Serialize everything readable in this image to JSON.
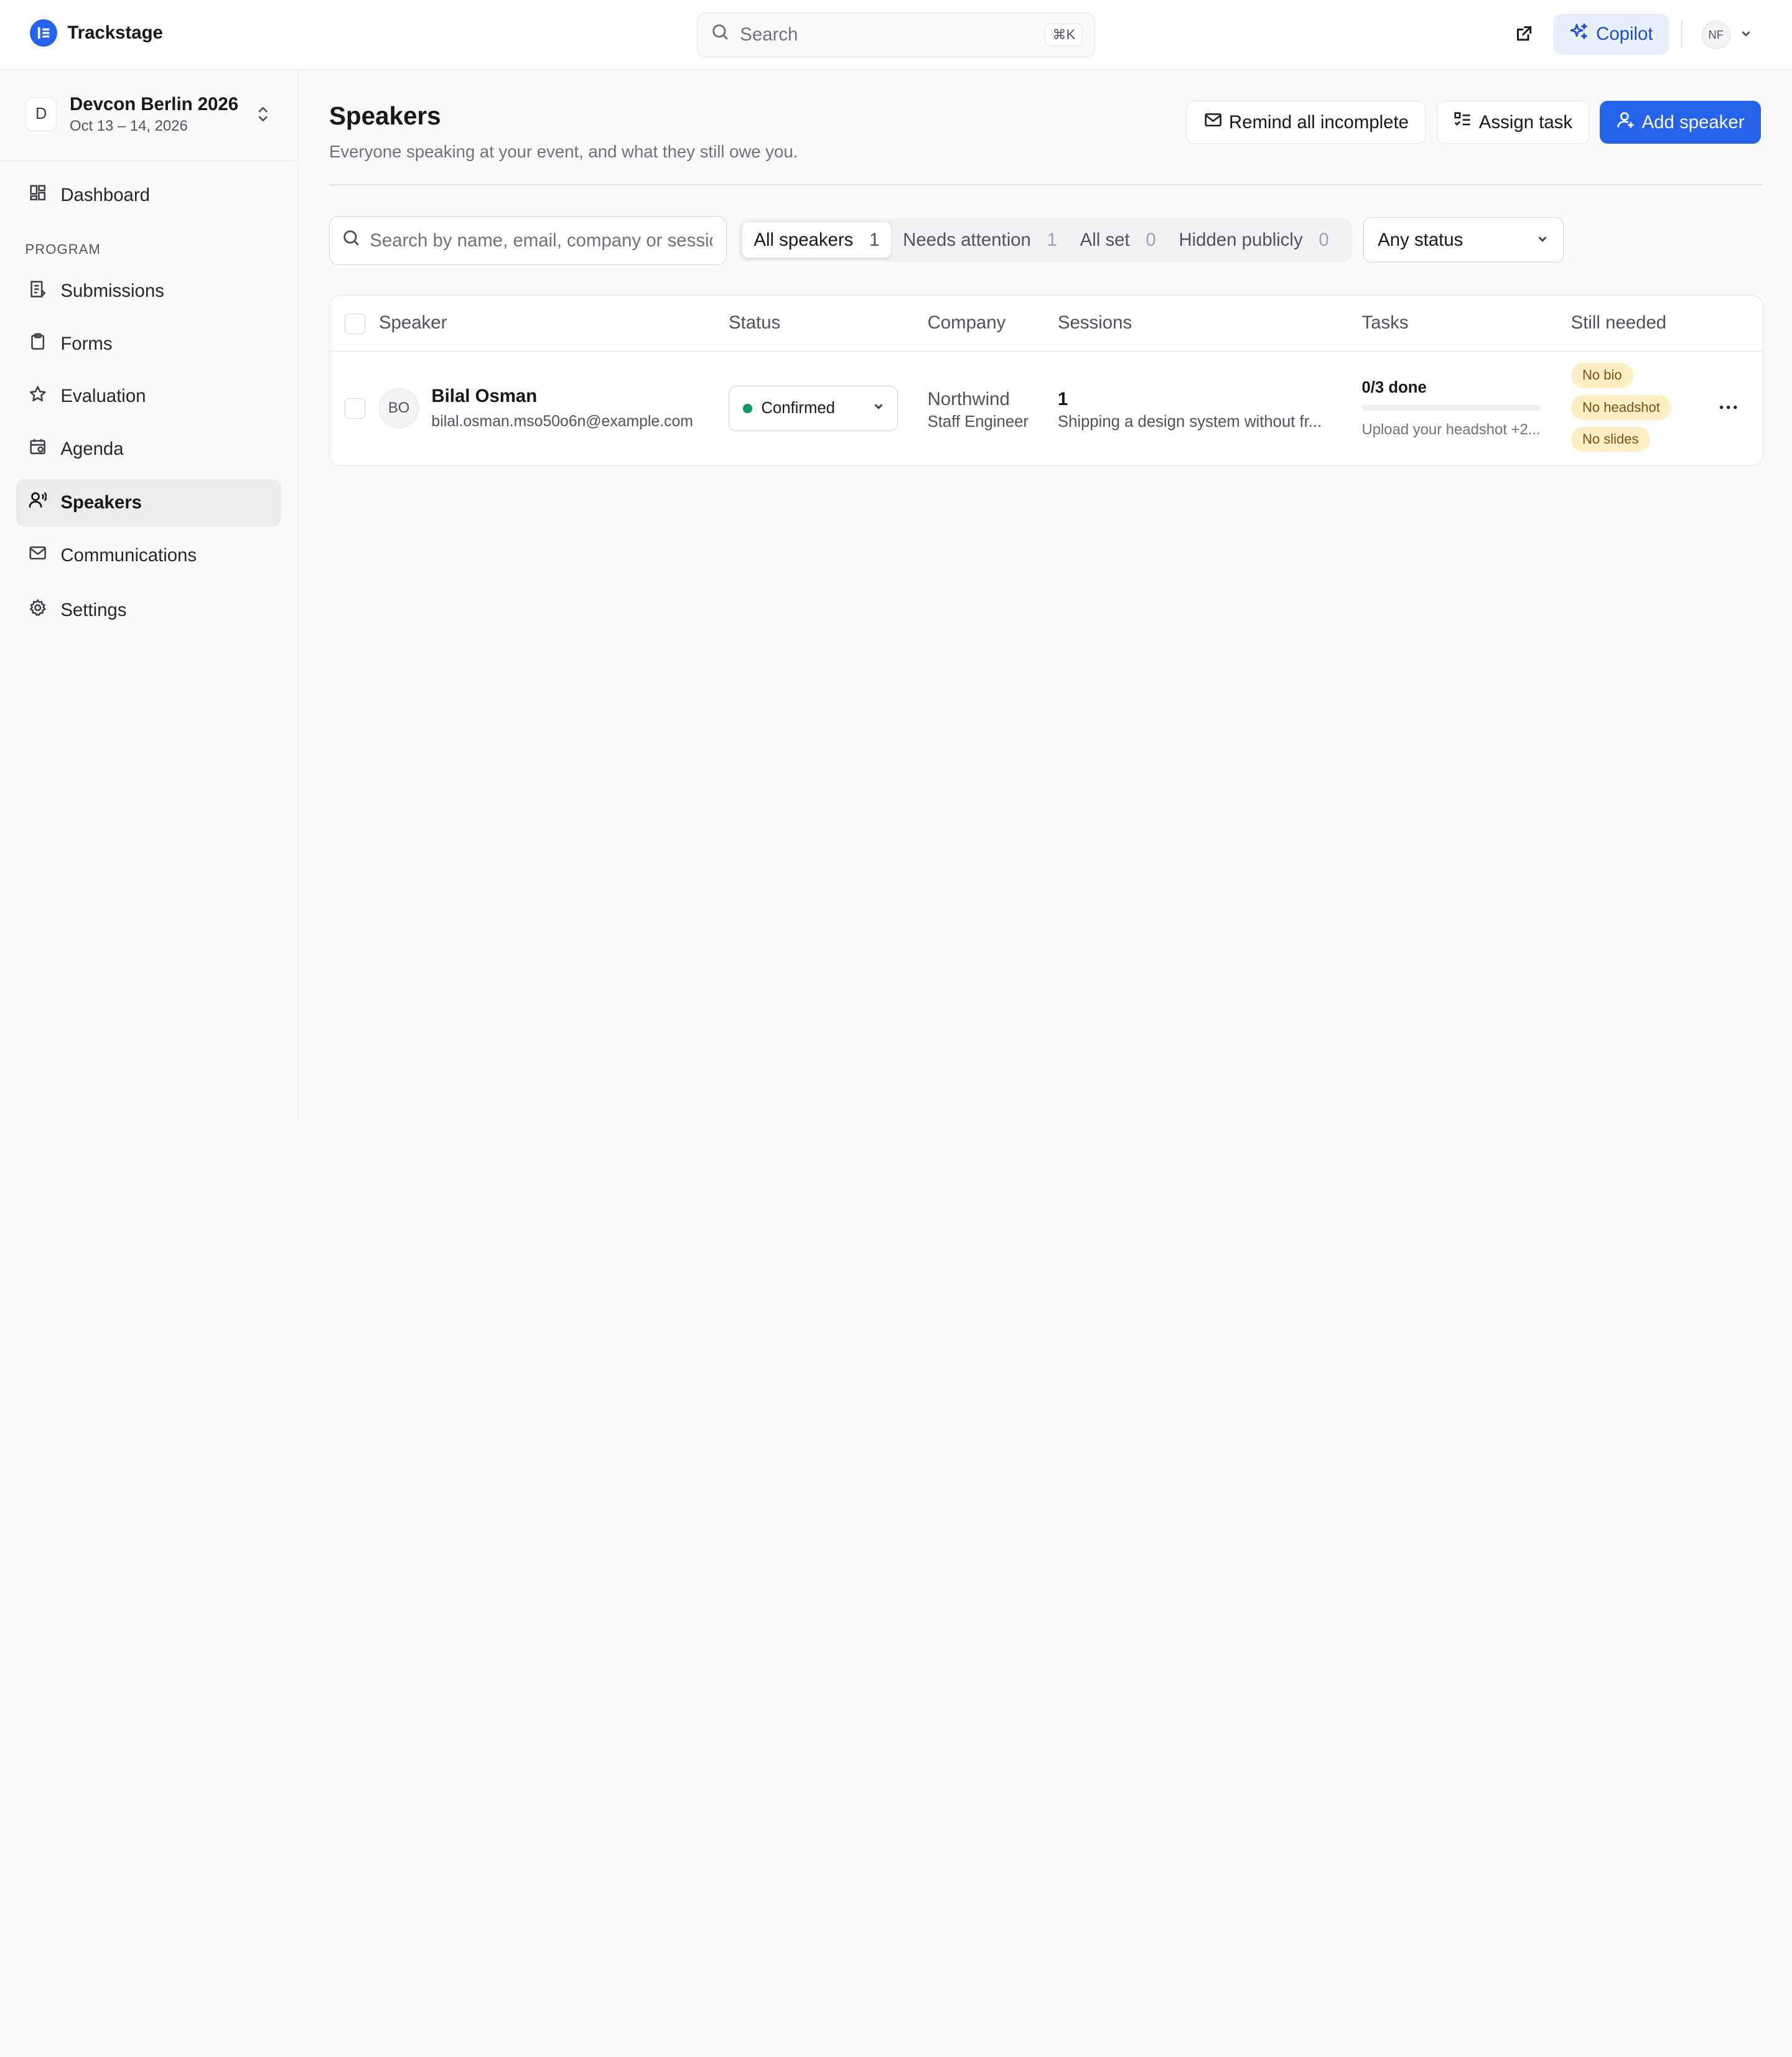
{
  "app": {
    "name": "Trackstage",
    "search_placeholder": "Search",
    "search_shortcut": "⌘K",
    "copilot_label": "Copilot",
    "user_initials": "NF",
    "accent": "#2563eb"
  },
  "event": {
    "badge": "D",
    "name": "Devcon Berlin 2026",
    "dates": "Oct 13 – 14, 2026"
  },
  "sidebar": {
    "dashboard": "Dashboard",
    "section_label": "PROGRAM",
    "items": [
      {
        "label": "Submissions",
        "icon": "submissions-icon"
      },
      {
        "label": "Forms",
        "icon": "clipboard-icon"
      },
      {
        "label": "Evaluation",
        "icon": "star-icon"
      },
      {
        "label": "Agenda",
        "icon": "calendar-icon"
      },
      {
        "label": "Speakers",
        "icon": "speaker-icon",
        "active": true
      },
      {
        "label": "Communications",
        "icon": "mail-icon"
      },
      {
        "label": "Settings",
        "icon": "gear-icon"
      }
    ]
  },
  "page": {
    "title": "Speakers",
    "subtitle": "Everyone speaking at your event, and what they still owe you.",
    "remind_label": "Remind all incomplete",
    "assign_label": "Assign task",
    "add_label": "Add speaker"
  },
  "filters": {
    "search_placeholder": "Search by name, email, company or session",
    "tabs": [
      {
        "label": "All speakers",
        "count": "1",
        "active": true
      },
      {
        "label": "Needs attention",
        "count": "1"
      },
      {
        "label": "All set",
        "count": "0"
      },
      {
        "label": "Hidden publicly",
        "count": "0"
      }
    ],
    "status_selected": "Any status"
  },
  "table": {
    "columns": [
      "Speaker",
      "Status",
      "Company",
      "Sessions",
      "Tasks",
      "Still needed"
    ],
    "rows": [
      {
        "initials": "BO",
        "name": "Bilal Osman",
        "email": "bilal.osman.mso50o6n@example.com",
        "status": "Confirmed",
        "status_color": "#059669",
        "company": "Northwind",
        "job_title": "Staff Engineer",
        "sessions_count": "1",
        "session_title": "Shipping a design system without fr...",
        "tasks_done": "0/3 done",
        "tasks_progress": 0,
        "tasks_next": "Upload your headshot +2...",
        "still_needed": [
          "No bio",
          "No headshot",
          "No slides"
        ]
      }
    ]
  }
}
